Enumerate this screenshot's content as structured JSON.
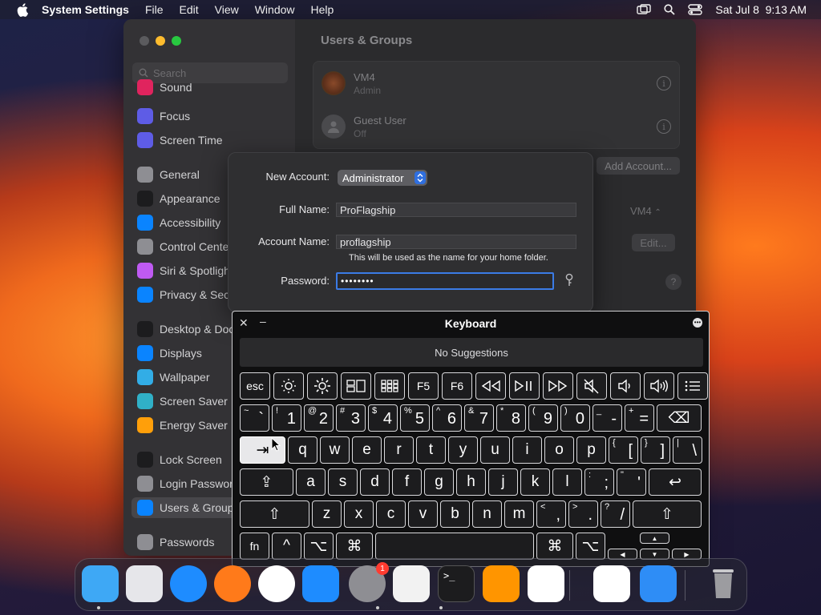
{
  "menubar": {
    "app_name": "System Settings",
    "menus": [
      "File",
      "Edit",
      "View",
      "Window",
      "Help"
    ],
    "datetime": "Sat Jul 8  9:13 AM"
  },
  "settings": {
    "search_placeholder": "Search",
    "sidebar": [
      {
        "label": "Sound",
        "icon": "sound-icon",
        "color": "#e0245e"
      },
      {
        "label": "Focus",
        "icon": "focus-icon",
        "color": "#5e5ce6"
      },
      {
        "label": "Screen Time",
        "icon": "screen-time-icon",
        "color": "#5e5ce6"
      },
      {
        "label": "General",
        "icon": "general-icon",
        "color": "#8e8e93"
      },
      {
        "label": "Appearance",
        "icon": "appearance-icon",
        "color": "#1c1c1e"
      },
      {
        "label": "Accessibility",
        "icon": "accessibility-icon",
        "color": "#0a84ff"
      },
      {
        "label": "Control Center",
        "icon": "control-center-icon",
        "color": "#8e8e93"
      },
      {
        "label": "Siri & Spotlight",
        "icon": "siri-icon",
        "color": "#bf5af2"
      },
      {
        "label": "Privacy & Security",
        "icon": "privacy-icon",
        "color": "#0a84ff"
      },
      {
        "label": "Desktop & Dock",
        "icon": "desktop-dock-icon",
        "color": "#1c1c1e"
      },
      {
        "label": "Displays",
        "icon": "displays-icon",
        "color": "#0a84ff"
      },
      {
        "label": "Wallpaper",
        "icon": "wallpaper-icon",
        "color": "#32ade6"
      },
      {
        "label": "Screen Saver",
        "icon": "screen-saver-icon",
        "color": "#30b0c7"
      },
      {
        "label": "Energy Saver",
        "icon": "energy-saver-icon",
        "color": "#ff9f0a"
      },
      {
        "label": "Lock Screen",
        "icon": "lock-screen-icon",
        "color": "#1c1c1e"
      },
      {
        "label": "Login Password",
        "icon": "login-password-icon",
        "color": "#8e8e93"
      },
      {
        "label": "Users & Groups",
        "icon": "users-groups-icon",
        "color": "#0a84ff"
      },
      {
        "label": "Passwords",
        "icon": "passwords-icon",
        "color": "#8e8e93"
      }
    ],
    "main_title": "Users & Groups",
    "users": [
      {
        "name": "VM4",
        "role": "Admin"
      },
      {
        "name": "Guest User",
        "role": "Off"
      }
    ],
    "add_account_label": "Add Account...",
    "auto_login_value": "VM4",
    "edit_label": "Edit...",
    "help_label": "?"
  },
  "sheet": {
    "new_account_label": "New Account:",
    "new_account_value": "Administrator",
    "full_name_label": "Full Name:",
    "full_name_value": "ProFlagship",
    "account_name_label": "Account Name:",
    "account_name_value": "proflagship",
    "account_name_hint": "This will be used as the name for your home folder.",
    "password_label": "Password:",
    "password_value": "••••••••"
  },
  "keyboard": {
    "title": "Keyboard",
    "suggestions": "No Suggestions",
    "fn_row": [
      "esc",
      "brightness-down-icon",
      "brightness-up-icon",
      "mission-control-icon",
      "launchpad-icon",
      "F5",
      "F6",
      "rewind-icon",
      "play-pause-icon",
      "fast-forward-icon",
      "mute-icon",
      "volume-down-icon",
      "volume-up-icon",
      "list-icon"
    ],
    "number_row": [
      [
        "~",
        "`"
      ],
      [
        "!",
        "1"
      ],
      [
        "@",
        "2"
      ],
      [
        "#",
        "3"
      ],
      [
        "$",
        "4"
      ],
      [
        "%",
        "5"
      ],
      [
        "^",
        "6"
      ],
      [
        "&",
        "7"
      ],
      [
        "*",
        "8"
      ],
      [
        "(",
        "9"
      ],
      [
        ")",
        "0"
      ],
      [
        "_",
        "-"
      ],
      [
        "+",
        "="
      ]
    ],
    "delete_label": "⌫",
    "tab_label": "⇥",
    "row_q": [
      "q",
      "w",
      "e",
      "r",
      "t",
      "y",
      "u",
      "i",
      "o",
      "p"
    ],
    "row_q_sym": [
      [
        "{",
        "["
      ],
      [
        "}",
        "]"
      ],
      [
        "|",
        "\\"
      ]
    ],
    "caps_label": "⇪",
    "row_a": [
      "a",
      "s",
      "d",
      "f",
      "g",
      "h",
      "j",
      "k",
      "l"
    ],
    "row_a_sym": [
      [
        ":",
        ";"
      ],
      [
        "\"",
        "'"
      ]
    ],
    "return_label": "↩",
    "shift_label": "⇧",
    "row_z": [
      "z",
      "x",
      "c",
      "v",
      "b",
      "n",
      "m"
    ],
    "row_z_sym": [
      [
        "<",
        ","
      ],
      [
        ">",
        "."
      ],
      [
        "?",
        "/"
      ]
    ],
    "fn_label": "fn",
    "ctrl_label": "^",
    "opt_label": "⌥",
    "cmd_label": "⌘",
    "arrows": {
      "up": "▲",
      "left": "◀",
      "down": "▼",
      "right": "▶"
    },
    "more_label": "•••"
  },
  "dock": {
    "items": [
      {
        "name": "finder-icon",
        "color": "#3ea8f5"
      },
      {
        "name": "launchpad-icon",
        "color": "#e6e6ea"
      },
      {
        "name": "safari-icon",
        "color": "#1e8cff"
      },
      {
        "name": "firefox-icon",
        "color": "#ff7a1a"
      },
      {
        "name": "chrome-icon",
        "color": "#ffffff"
      },
      {
        "name": "app-store-icon",
        "color": "#1e8cff"
      },
      {
        "name": "system-settings-icon",
        "color": "#8e8e93"
      },
      {
        "name": "textedit-icon",
        "color": "#f2f2f2"
      },
      {
        "name": "terminal-icon",
        "color": "#1c1c1e"
      },
      {
        "name": "garageband-icon",
        "color": "#ff9500"
      },
      {
        "name": "vscode-icon",
        "color": "#ffffff"
      },
      {
        "name": "visual-studio-icon",
        "color": "#ffffff"
      },
      {
        "name": "weather-icon",
        "color": "#2e8df6"
      },
      {
        "name": "trash-icon",
        "color": "#b5b5b8"
      }
    ],
    "settings_badge": "1",
    "terminal_prompt": ">_"
  }
}
